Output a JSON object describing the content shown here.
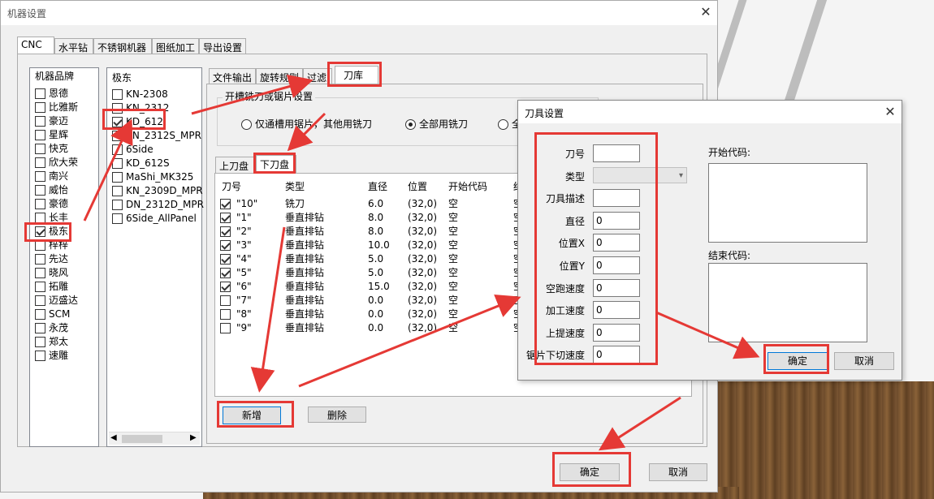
{
  "main_window": {
    "title": "机器设置",
    "tabs": [
      "CNC",
      "水平钻",
      "不锈钢机器",
      "图纸加工",
      "导出设置"
    ],
    "brand_header": "机器品牌",
    "brands": [
      {
        "label": "恩德",
        "checked": false
      },
      {
        "label": "比雅斯",
        "checked": false
      },
      {
        "label": "豪迈",
        "checked": false
      },
      {
        "label": "星辉",
        "checked": false
      },
      {
        "label": "快克",
        "checked": false
      },
      {
        "label": "欣大荣",
        "checked": false
      },
      {
        "label": "南兴",
        "checked": false
      },
      {
        "label": "威怡",
        "checked": false
      },
      {
        "label": "豪德",
        "checked": false
      },
      {
        "label": "长丰",
        "checked": false
      },
      {
        "label": "极东",
        "checked": true
      },
      {
        "label": "梓梓",
        "checked": false
      },
      {
        "label": "先达",
        "checked": false
      },
      {
        "label": "晓风",
        "checked": false
      },
      {
        "label": "拓雕",
        "checked": false
      },
      {
        "label": "迈盛达",
        "checked": false
      },
      {
        "label": "SCM",
        "checked": false
      },
      {
        "label": "永茂",
        "checked": false
      },
      {
        "label": "郑太",
        "checked": false
      },
      {
        "label": "速雕",
        "checked": false
      }
    ],
    "model_header": "极东",
    "models": [
      {
        "label": "KN-2308",
        "checked": false
      },
      {
        "label": "KN_2312",
        "checked": false
      },
      {
        "label": "KD_612",
        "checked": true
      },
      {
        "label": "KN_2312S_MPR",
        "checked": false
      },
      {
        "label": "6Side",
        "checked": false
      },
      {
        "label": "KD_612S",
        "checked": false
      },
      {
        "label": "MaShi_MK325",
        "checked": false
      },
      {
        "label": "KN_2309D_MPR",
        "checked": false
      },
      {
        "label": "DN_2312D_MPR",
        "checked": false
      },
      {
        "label": "6Side_AllPanel",
        "checked": false
      }
    ],
    "sub_tabs": [
      "文件输出",
      "旋转规则",
      "过滤",
      "刀库"
    ],
    "group_title": "开槽铣刀或锯片设置",
    "radio_options": [
      {
        "label": "仅通槽用锯片，其他用铣刀",
        "selected": false
      },
      {
        "label": "全部用铣刀",
        "selected": true
      },
      {
        "label": "全",
        "selected": false
      }
    ],
    "disk_tabs": [
      "上刀盘",
      "下刀盘"
    ],
    "tool_table": {
      "columns": [
        "刀号",
        "类型",
        "直径",
        "位置",
        "开始代码",
        "结"
      ],
      "rows": [
        {
          "no": "\"10\"",
          "type": "铣刀",
          "dia": "6.0",
          "pos": "(32,0)",
          "start": "空",
          "end": "空",
          "checked": true
        },
        {
          "no": "\"1\"",
          "type": "垂直排钻",
          "dia": "8.0",
          "pos": "(32,0)",
          "start": "空",
          "end": "空",
          "checked": true
        },
        {
          "no": "\"2\"",
          "type": "垂直排钻",
          "dia": "8.0",
          "pos": "(32,0)",
          "start": "空",
          "end": "空",
          "checked": true
        },
        {
          "no": "\"3\"",
          "type": "垂直排钻",
          "dia": "10.0",
          "pos": "(32,0)",
          "start": "空",
          "end": "空",
          "checked": true
        },
        {
          "no": "\"4\"",
          "type": "垂直排钻",
          "dia": "5.0",
          "pos": "(32,0)",
          "start": "空",
          "end": "空",
          "checked": true
        },
        {
          "no": "\"5\"",
          "type": "垂直排钻",
          "dia": "5.0",
          "pos": "(32,0)",
          "start": "空",
          "end": "空",
          "checked": true
        },
        {
          "no": "\"6\"",
          "type": "垂直排钻",
          "dia": "15.0",
          "pos": "(32,0)",
          "start": "空",
          "end": "空",
          "checked": true
        },
        {
          "no": "\"7\"",
          "type": "垂直排钻",
          "dia": "0.0",
          "pos": "(32,0)",
          "start": "空",
          "end": "空",
          "checked": false
        },
        {
          "no": "\"8\"",
          "type": "垂直排钻",
          "dia": "0.0",
          "pos": "(32,0)",
          "start": "空",
          "end": "空",
          "checked": false
        },
        {
          "no": "\"9\"",
          "type": "垂直排钻",
          "dia": "0.0",
          "pos": "(32,0)",
          "start": "空",
          "end": "空",
          "checked": false
        }
      ]
    },
    "add_button": "新增",
    "delete_button": "删除",
    "ok_button": "确定",
    "cancel_button": "取消"
  },
  "tool_dialog": {
    "title": "刀具设置",
    "fields": [
      {
        "label": "刀号",
        "value": ""
      },
      {
        "label": "类型",
        "value": ""
      },
      {
        "label": "刀具描述",
        "value": ""
      },
      {
        "label": "直径",
        "value": "0"
      },
      {
        "label": "位置X",
        "value": "0"
      },
      {
        "label": "位置Y",
        "value": "0"
      },
      {
        "label": "空跑速度",
        "value": "0"
      },
      {
        "label": "加工速度",
        "value": "0"
      },
      {
        "label": "上提速度",
        "value": "0"
      },
      {
        "label": "锯片下切速度",
        "value": "0"
      }
    ],
    "start_code_label": "开始代码:",
    "end_code_label": "结束代码:",
    "ok_button": "确定",
    "cancel_button": "取消"
  },
  "colors": {
    "highlight": "#e53935",
    "accent": "#0078d7",
    "window_bg": "#f0f0f0"
  }
}
